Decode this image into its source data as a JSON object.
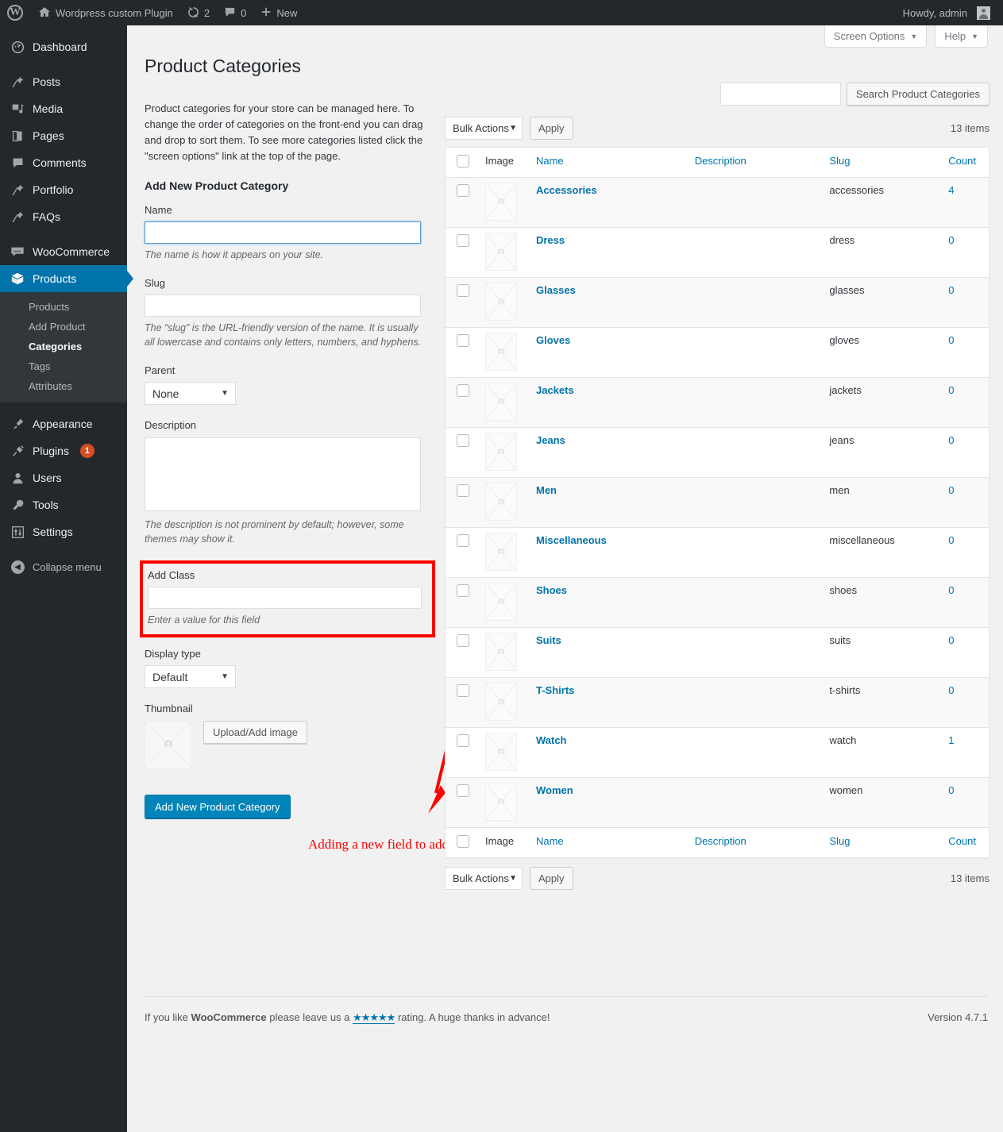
{
  "adminbar": {
    "logo_icon": "wordpress-logo-icon",
    "site_name": "Wordpress custom Plugin",
    "home_icon": "home-icon",
    "updates_icon": "updates-icon",
    "updates_count": "2",
    "comments_icon": "comment-bubble-icon",
    "comments_count": "0",
    "new_icon": "plus-icon",
    "new_label": "New",
    "howdy": "Howdy, admin",
    "avatar_icon": "avatar-icon"
  },
  "sidebar": {
    "items": [
      {
        "label": "Dashboard",
        "icon": "dashboard-icon",
        "current": false
      },
      {
        "label": "Posts",
        "icon": "pin-icon",
        "current": false
      },
      {
        "label": "Media",
        "icon": "media-icon",
        "current": false
      },
      {
        "label": "Pages",
        "icon": "pages-icon",
        "current": false
      },
      {
        "label": "Comments",
        "icon": "comment-bubble-icon",
        "current": false
      },
      {
        "label": "Portfolio",
        "icon": "pin-icon",
        "current": false
      },
      {
        "label": "FAQs",
        "icon": "pin-icon",
        "current": false
      },
      {
        "label": "WooCommerce",
        "icon": "woocommerce-icon",
        "current": false
      },
      {
        "label": "Products",
        "icon": "products-box-icon",
        "current": true
      }
    ],
    "submenu": [
      {
        "label": "Products",
        "current": false
      },
      {
        "label": "Add Product",
        "current": false
      },
      {
        "label": "Categories",
        "current": true
      },
      {
        "label": "Tags",
        "current": false
      },
      {
        "label": "Attributes",
        "current": false
      }
    ],
    "items_lower": [
      {
        "label": "Appearance",
        "icon": "paintbrush-icon",
        "badge": ""
      },
      {
        "label": "Plugins",
        "icon": "plug-icon",
        "badge": "1"
      },
      {
        "label": "Users",
        "icon": "user-icon",
        "badge": ""
      },
      {
        "label": "Tools",
        "icon": "wrench-icon",
        "badge": ""
      },
      {
        "label": "Settings",
        "icon": "sliders-icon",
        "badge": ""
      }
    ],
    "collapse_label": "Collapse menu",
    "collapse_icon": "chevron-left-icon",
    "accent_color": "#0073aa",
    "badge_color": "#d54e21"
  },
  "screen_meta": {
    "screen_options_label": "Screen Options",
    "help_label": "Help",
    "caret_icon": "caret-down-icon"
  },
  "page": {
    "title": "Product Categories"
  },
  "form": {
    "intro": "Product categories for your store can be managed here. To change the order of categories on the front-end you can drag and drop to sort them. To see more categories listed click the \"screen options\" link at the top of the page.",
    "heading": "Add New Product Category",
    "name_label": "Name",
    "name_value": "",
    "name_desc": "The name is how it appears on your site.",
    "slug_label": "Slug",
    "slug_value": "",
    "slug_desc": "The “slug” is the URL-friendly version of the name. It is usually all lowercase and contains only letters, numbers, and hyphens.",
    "parent_label": "Parent",
    "parent_value": "None",
    "description_label": "Description",
    "description_value": "",
    "description_desc": "The description is not prominent by default; however, some themes may show it.",
    "addclass_label": "Add Class",
    "addclass_value": "",
    "addclass_desc": "Enter a value for this field",
    "display_type_label": "Display type",
    "display_type_value": "Default",
    "thumbnail_label": "Thumbnail",
    "thumbnail_icon": "image-placeholder-icon",
    "upload_button": "Upload/Add image",
    "submit_button": "Add New Product Category",
    "highlight_color": "#fe0000"
  },
  "annotation": {
    "text": "Adding a new field to add class",
    "color": "#fe0000",
    "arrow_icon": "arrow-down-left-icon"
  },
  "search": {
    "value": "",
    "button_label": "Search Product Categories"
  },
  "tablenav": {
    "bulk_actions_label": "Bulk Actions",
    "caret_icon": "caret-down-icon",
    "apply_label": "Apply",
    "items_count": "13 items"
  },
  "table": {
    "columns": [
      "Image",
      "Name",
      "Description",
      "Slug",
      "Count"
    ],
    "sortable": [
      false,
      true,
      true,
      true,
      true
    ],
    "select_all_icon": "checkbox-icon",
    "row_image_icon": "image-placeholder-icon",
    "rows": [
      {
        "name": "Accessories",
        "description": "",
        "slug": "accessories",
        "count": "4"
      },
      {
        "name": "Dress",
        "description": "",
        "slug": "dress",
        "count": "0"
      },
      {
        "name": "Glasses",
        "description": "",
        "slug": "glasses",
        "count": "0"
      },
      {
        "name": "Gloves",
        "description": "",
        "slug": "gloves",
        "count": "0"
      },
      {
        "name": "Jackets",
        "description": "",
        "slug": "jackets",
        "count": "0"
      },
      {
        "name": "Jeans",
        "description": "",
        "slug": "jeans",
        "count": "0"
      },
      {
        "name": "Men",
        "description": "",
        "slug": "men",
        "count": "0"
      },
      {
        "name": "Miscellaneous",
        "description": "",
        "slug": "miscellaneous",
        "count": "0"
      },
      {
        "name": "Shoes",
        "description": "",
        "slug": "shoes",
        "count": "0"
      },
      {
        "name": "Suits",
        "description": "",
        "slug": "suits",
        "count": "0"
      },
      {
        "name": "T-Shirts",
        "description": "",
        "slug": "t-shirts",
        "count": "0"
      },
      {
        "name": "Watch",
        "description": "",
        "slug": "watch",
        "count": "1"
      },
      {
        "name": "Women",
        "description": "",
        "slug": "women",
        "count": "0"
      }
    ]
  },
  "footer": {
    "text_before": "If you like ",
    "product": "WooCommerce",
    "text_middle": " please leave us a ",
    "stars": "★★★★★",
    "text_after": " rating. A huge thanks in advance!",
    "version": "Version 4.7.1"
  }
}
